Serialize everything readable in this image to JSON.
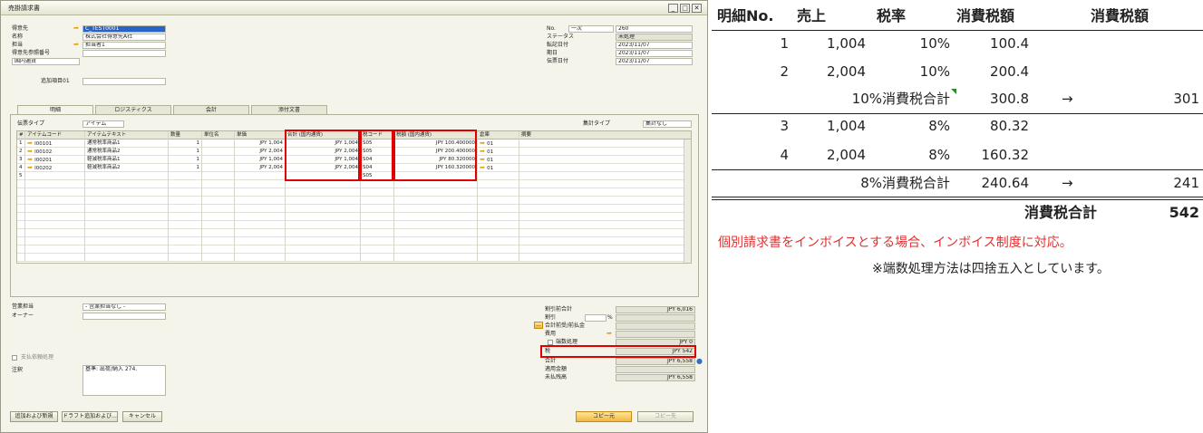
{
  "window": {
    "title": "売掛請求書",
    "min": "_",
    "max": "□",
    "close": "✕"
  },
  "header": {
    "bp_label": "得意先",
    "bp_value": "C_TEST0001",
    "name_label": "名称",
    "name_value": "株式会社得意先A社",
    "contact_label": "担当",
    "contact_value": "担当者1",
    "ref_label": "得意先参照番号",
    "currency_value": "国内通貨",
    "no_label": "No.",
    "series_value": "一次",
    "no_value": "260",
    "status_label": "ステータス",
    "status_value": "未処理",
    "posting_label": "転記日付",
    "posting_value": "2023/11/07",
    "due_label": "期日",
    "due_value": "2023/11/07",
    "doc_label": "伝票日付",
    "doc_value": "2023/11/07",
    "extra_label": "追加項目01"
  },
  "tabs": [
    {
      "label": "明細"
    },
    {
      "label": "ロジスティクス"
    },
    {
      "label": "会計"
    },
    {
      "label": "添付文書"
    }
  ],
  "grid": {
    "doctype_label": "伝票タイプ",
    "doctype_value": "アイテム",
    "sum_label": "集計タイプ",
    "sum_value": "集計なし",
    "columns": [
      "#",
      "アイテムコード",
      "アイテムテキスト",
      "数量",
      "単位名",
      "単価",
      "合計 (国内通貨)",
      "税コード",
      "税額 (国内通貨)",
      "倉庫",
      "摘要"
    ],
    "rows": [
      {
        "no": "1",
        "code": "I00101",
        "text": "通常税率商品1",
        "qty": "1",
        "price": "JPY 1,004",
        "total": "JPY 1,004",
        "tax": "S05",
        "taxamt": "JPY 100.400000",
        "wh": "01"
      },
      {
        "no": "2",
        "code": "I00102",
        "text": "通常税率商品2",
        "qty": "1",
        "price": "JPY 2,004",
        "total": "JPY 2,004",
        "tax": "S05",
        "taxamt": "JPY 200.400000",
        "wh": "01"
      },
      {
        "no": "3",
        "code": "I00201",
        "text": "軽減税率商品1",
        "qty": "1",
        "price": "JPY 1,004",
        "total": "JPY 1,004",
        "tax": "S04",
        "taxamt": "JPY 80.320000",
        "wh": "01"
      },
      {
        "no": "4",
        "code": "I00202",
        "text": "軽減税率商品2",
        "qty": "1",
        "price": "JPY 2,004",
        "total": "JPY 2,004",
        "tax": "S04",
        "taxamt": "JPY 160.320000",
        "wh": "01"
      },
      {
        "no": "5",
        "code": "",
        "text": "",
        "qty": "",
        "price": "",
        "total": "",
        "tax": "S05",
        "taxamt": "",
        "wh": ""
      }
    ]
  },
  "footer": {
    "sales_label": "営業担当",
    "sales_value": "- 営業担当なし -",
    "owner_label": "オーナー",
    "payment_label": "支払依頼処理",
    "remarks_label": "注釈",
    "remarks_value": "基準: 出荷/納入 274.",
    "before_disc_label": "割引前合計",
    "before_disc_value": "JPY 6,016",
    "disc_label": "割引",
    "pct": "%",
    "downpay_label": "合計前受/前払金",
    "freight_label": "費用",
    "rounding_label": "端数処理",
    "rounding_value": "JPY 0",
    "tax_label": "税",
    "tax_value": "JPY 542",
    "total_label": "合計",
    "total_value": "JPY 6,558",
    "applied_label": "適用金額",
    "balance_label": "未払残高",
    "balance_value": "JPY 6,558",
    "dots": "..."
  },
  "buttons": {
    "add_new": "追加および新規",
    "draft": "ドラフト追加および...",
    "cancel": "キャンセル",
    "copy_from": "コピー元",
    "copy_to": "コピー先"
  },
  "summary": {
    "headers": [
      "明細No.",
      "売上",
      "税率",
      "消費税額",
      "消費税額"
    ],
    "rows": [
      {
        "no": "1",
        "sales": "1,004",
        "rate": "10%",
        "tax": "100.4"
      },
      {
        "no": "2",
        "sales": "2,004",
        "rate": "10%",
        "tax": "200.4"
      }
    ],
    "sub10": {
      "label": "10%消費税合計",
      "value": "300.8",
      "arrow": "→",
      "rounded": "301"
    },
    "rows8": [
      {
        "no": "3",
        "sales": "1,004",
        "rate": "8%",
        "tax": "80.32"
      },
      {
        "no": "4",
        "sales": "2,004",
        "rate": "8%",
        "tax": "160.32"
      }
    ],
    "sub8": {
      "label": "8%消費税合計",
      "value": "240.64",
      "arrow": "→",
      "rounded": "241"
    },
    "grand": {
      "label": "消費税合計",
      "value": "542"
    },
    "note1": "個別請求書をインボイスとする場合、インボイス制度に対応。",
    "note2": "※端数処理方法は四捨五入としています。"
  },
  "colors": {
    "red": "#e00000",
    "note_red": "#e03030"
  }
}
